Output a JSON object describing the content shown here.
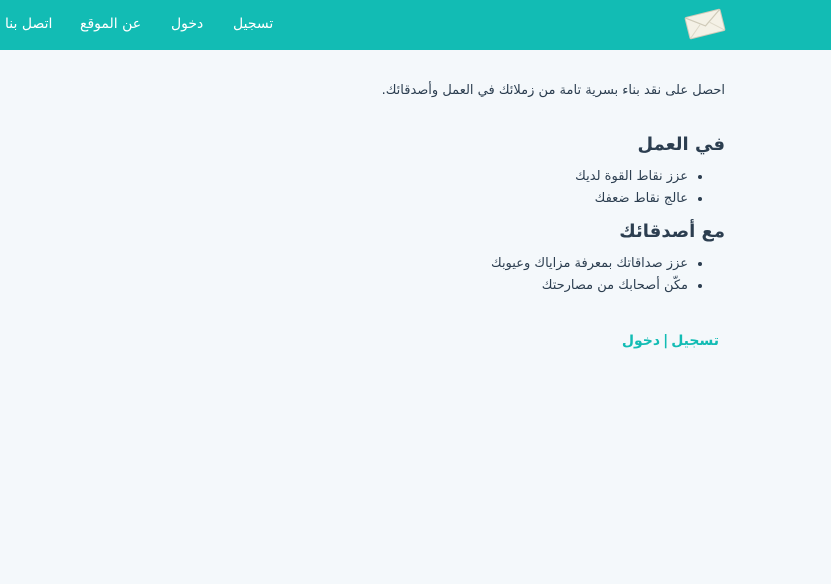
{
  "nav": {
    "register": "تسجيل",
    "login": "دخول",
    "about": "عن الموقع",
    "contact": "اتصل بنا"
  },
  "logo": {
    "icon": "envelope-icon"
  },
  "intro": "احصل على نقد بناء بسرية تامة من زملائك في العمل وأصدقائك.",
  "sections": [
    {
      "heading": "في العمل",
      "items": [
        "عزز نقاط القوة لديك",
        "عالج نقاط ضعفك"
      ]
    },
    {
      "heading": "مع أصدقائك",
      "items": [
        "عزز صداقاتك بمعرفة مزاياك وعيوبك",
        "مكّن أصحابك من مصارحتك"
      ]
    }
  ],
  "footer": {
    "register": "تسجيل",
    "separator": "|",
    "login": "دخول"
  },
  "colors": {
    "brand": "#12bcb4",
    "background": "#f4f8fb",
    "text": "#2c3e50"
  }
}
